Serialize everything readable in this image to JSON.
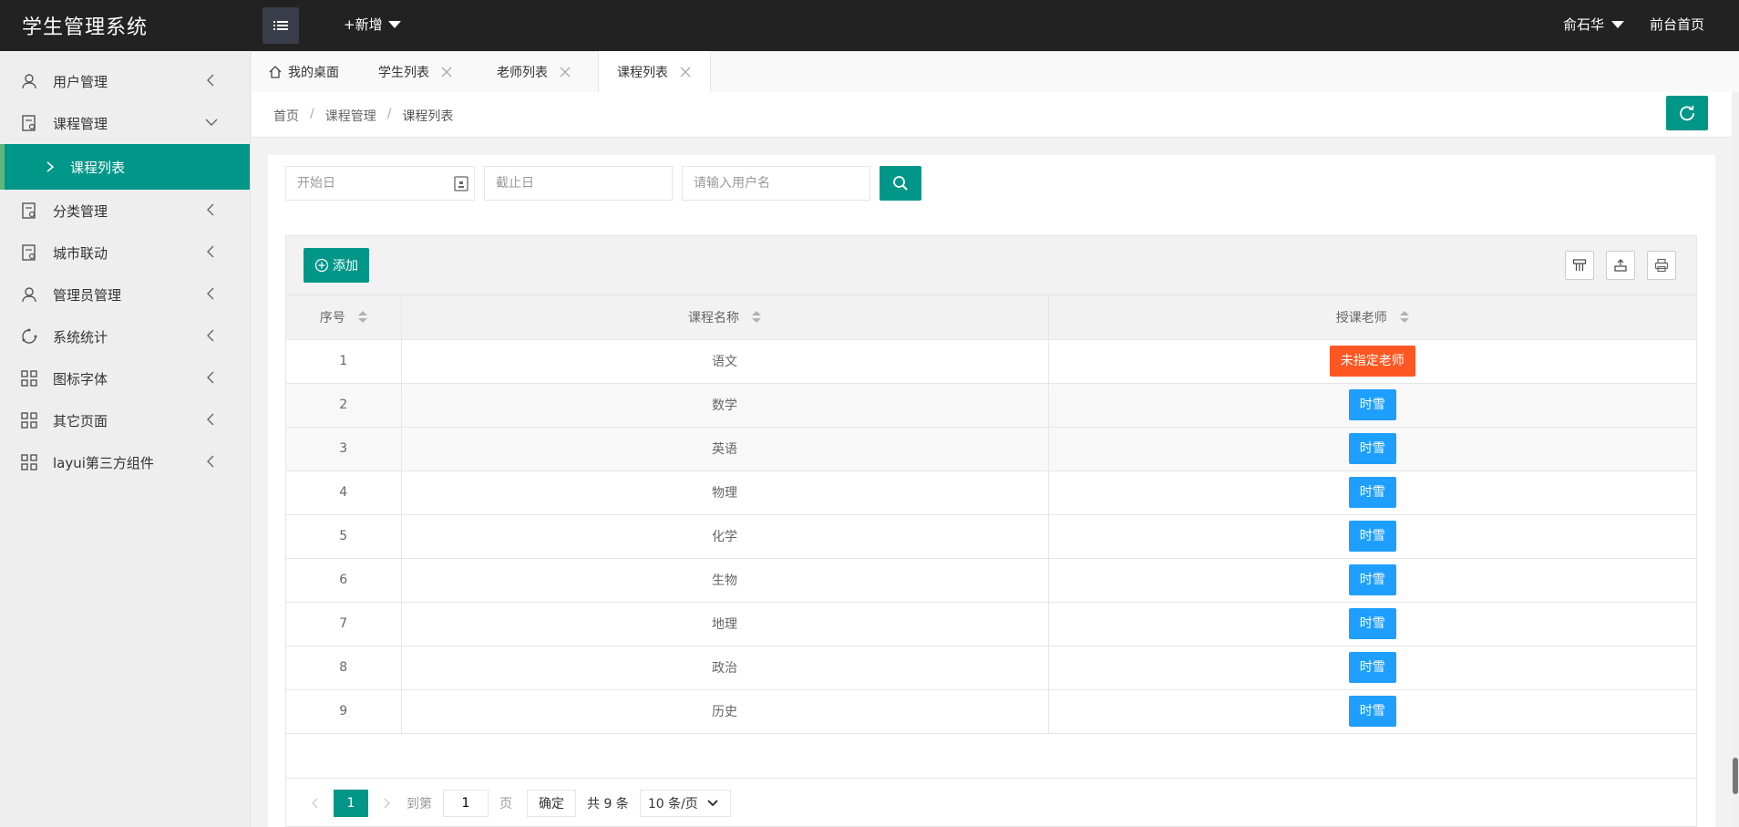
{
  "app": {
    "title": "学生管理系统"
  },
  "header": {
    "add_new": "+新增",
    "user": "俞石华",
    "home_link": "前台首页"
  },
  "sidebar": {
    "items": [
      {
        "label": "用户管理",
        "icon": "user-icon",
        "expanded": false
      },
      {
        "label": "课程管理",
        "icon": "document-icon",
        "expanded": true
      },
      {
        "label": "课程列表",
        "icon": "chevron-right-icon",
        "sub": true,
        "active": true
      },
      {
        "label": "分类管理",
        "icon": "document-icon",
        "expanded": false
      },
      {
        "label": "城市联动",
        "icon": "document-icon",
        "expanded": false
      },
      {
        "label": "管理员管理",
        "icon": "user-icon",
        "expanded": false
      },
      {
        "label": "系统统计",
        "icon": "chart-icon",
        "expanded": false
      },
      {
        "label": "图标字体",
        "icon": "grid-icon",
        "expanded": false
      },
      {
        "label": "其它页面",
        "icon": "grid-icon",
        "expanded": false
      },
      {
        "label": "layui第三方组件",
        "icon": "grid-icon",
        "expanded": false
      }
    ]
  },
  "tabs": [
    {
      "label": "我的桌面",
      "icon": "home-icon",
      "closable": false
    },
    {
      "label": "学生列表",
      "closable": true
    },
    {
      "label": "老师列表",
      "closable": true
    },
    {
      "label": "课程列表",
      "closable": true,
      "active": true
    }
  ],
  "breadcrumb": {
    "items": [
      "首页",
      "课程管理",
      "课程列表"
    ],
    "separator": "/"
  },
  "filters": {
    "start_placeholder": "开始日",
    "end_placeholder": "截止日",
    "username_placeholder": "请输入用户名"
  },
  "table": {
    "add_label": "添加",
    "columns": [
      "序号",
      "课程名称",
      "授课老师"
    ],
    "rows": [
      {
        "id": "1",
        "name": "语文",
        "teacher": "未指定老师",
        "status": "unassigned"
      },
      {
        "id": "2",
        "name": "数学",
        "teacher": "时雪",
        "status": "assigned"
      },
      {
        "id": "3",
        "name": "英语",
        "teacher": "时雪",
        "status": "assigned"
      },
      {
        "id": "4",
        "name": "物理",
        "teacher": "时雪",
        "status": "assigned"
      },
      {
        "id": "5",
        "name": "化学",
        "teacher": "时雪",
        "status": "assigned"
      },
      {
        "id": "6",
        "name": "生物",
        "teacher": "时雪",
        "status": "assigned"
      },
      {
        "id": "7",
        "name": "地理",
        "teacher": "时雪",
        "status": "assigned"
      },
      {
        "id": "8",
        "name": "政治",
        "teacher": "时雪",
        "status": "assigned"
      },
      {
        "id": "9",
        "name": "历史",
        "teacher": "时雪",
        "status": "assigned"
      }
    ]
  },
  "pager": {
    "current": "1",
    "goto_label": "到第",
    "goto_value": "1",
    "page_label": "页",
    "confirm": "确定",
    "total": "共 9 条",
    "page_size": "10 条/页"
  },
  "colors": {
    "primary": "#009688",
    "orange": "#ff5722",
    "blue": "#1e9fff",
    "header_bg": "#222222"
  }
}
